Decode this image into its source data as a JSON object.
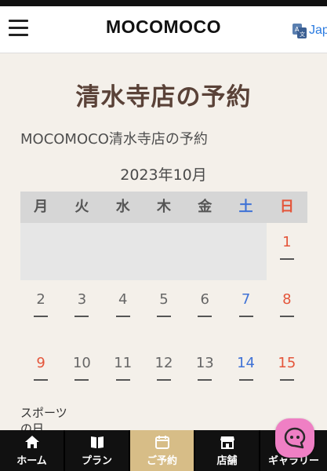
{
  "header": {
    "logo": "MOCOMOCO",
    "language_label": "Jap"
  },
  "page_title": "清水寺店の予約",
  "subtitle": "MOCOMOCO清水寺店の予約",
  "calendar": {
    "month": "2023年10月",
    "weekdays": [
      "月",
      "火",
      "水",
      "木",
      "金",
      "土",
      "日"
    ],
    "week1": {
      "sun": "1"
    },
    "week2": [
      "2",
      "3",
      "4",
      "5",
      "6",
      "7",
      "8"
    ],
    "week3": [
      "9",
      "10",
      "11",
      "12",
      "13",
      "14",
      "15"
    ],
    "holiday": "スポーツの日",
    "status_mark": "—"
  },
  "bottom_nav": [
    {
      "label": "ホーム",
      "icon": "home-icon"
    },
    {
      "label": "プラン",
      "icon": "book-icon"
    },
    {
      "label": "ご予約",
      "icon": "calendar-icon"
    },
    {
      "label": "店舗",
      "icon": "store-icon"
    },
    {
      "label": "ギャラリー",
      "icon": "gallery-icon"
    }
  ],
  "colors": {
    "background": "#f4f0ea",
    "title": "#5a4238",
    "saturday": "#3f72d6",
    "sunday": "#e4553a",
    "nav_active": "#d7bd87",
    "chat": "#ef7fc4"
  }
}
